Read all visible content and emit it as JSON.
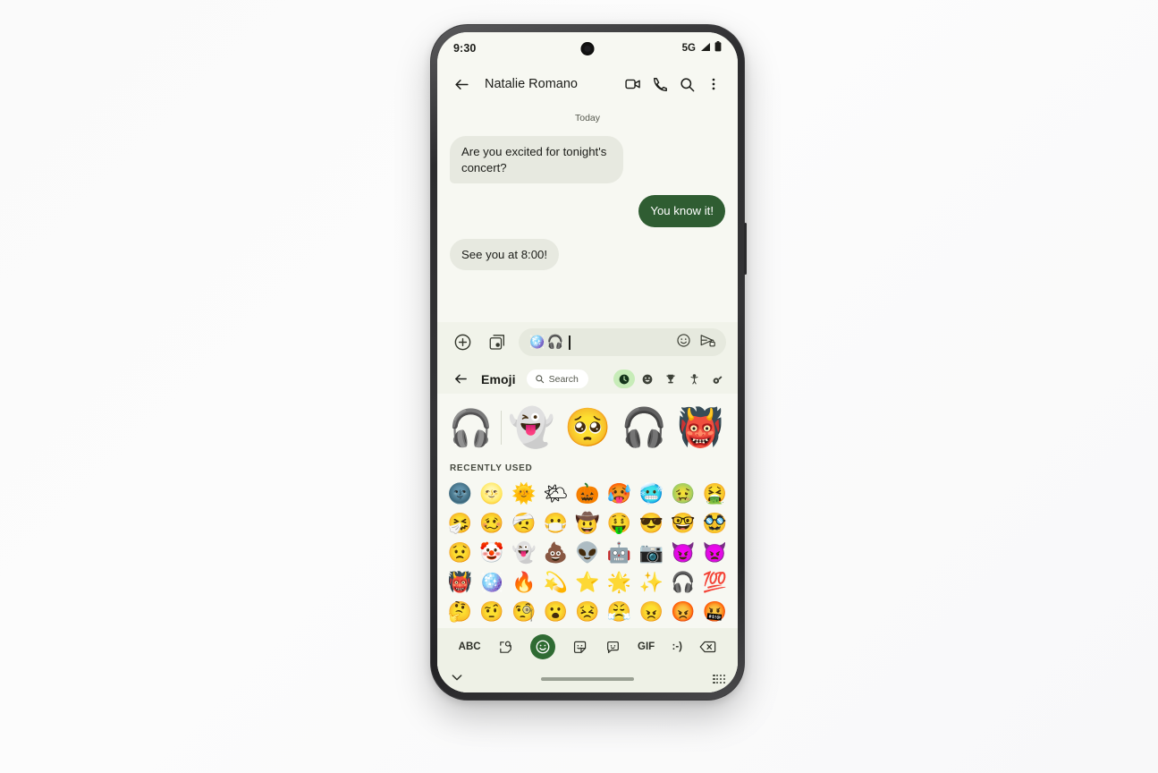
{
  "device": {
    "frame_color": "#3c3c3e",
    "screen_bg": "#f7f8f2"
  },
  "status_bar": {
    "time": "9:30",
    "network": "5G",
    "signal_icon": "signal-bars-icon",
    "battery_icon": "battery-icon"
  },
  "app_bar": {
    "back_icon": "back-arrow-icon",
    "contact_name": "Natalie Romano",
    "video_call_icon": "video-call-icon",
    "voice_call_icon": "phone-icon",
    "search_icon": "search-icon",
    "more_icon": "more-vert-icon"
  },
  "conversation": {
    "day_label": "Today",
    "messages": [
      {
        "text": "Are you excited for tonight's concert?",
        "side": "in"
      },
      {
        "text": "You know it!",
        "side": "out"
      },
      {
        "text": "See you at 8:00!",
        "side": "in"
      }
    ],
    "incoming_bubble_color": "#e7e9e0",
    "outgoing_bubble_color": "#2f5d32"
  },
  "compose_bar": {
    "add_icon": "plus-circle-icon",
    "gallery_icon": "gallery-icon",
    "input_value": "🪩🎧",
    "input_emoji": [
      "🪩",
      "🎧"
    ],
    "emoji_icon": "emoji-face-icon",
    "send_icon": "send-encrypted-icon"
  },
  "emoji_panel": {
    "back_icon": "back-arrow-icon",
    "title": "Emoji",
    "search": {
      "placeholder": "Search",
      "icon": "search-icon"
    },
    "categories": [
      {
        "name": "recent",
        "glyph": "🕐",
        "icon": "clock-icon",
        "selected": true
      },
      {
        "name": "smileys",
        "glyph": "😀",
        "icon": "smiley-icon",
        "selected": false
      },
      {
        "name": "activities",
        "glyph": "🏆",
        "icon": "trophy-icon",
        "selected": false
      },
      {
        "name": "people",
        "glyph": "🙋",
        "icon": "person-icon",
        "selected": false
      },
      {
        "name": "objects",
        "glyph": "🎸",
        "icon": "guitar-icon",
        "selected": false
      }
    ],
    "sticker_suggestions": [
      {
        "name": "blue-headphones-sticker",
        "glyph": "🎧"
      },
      {
        "name": "ghost-headphones-sticker",
        "glyph": "👻"
      },
      {
        "name": "pleading-headphones-sticker",
        "glyph": "🥺"
      },
      {
        "name": "sparkle-headphones-sticker",
        "glyph": "🎧"
      },
      {
        "name": "ogre-headphones-sticker",
        "glyph": "👹"
      }
    ],
    "section_label": "RECENTLY USED",
    "grid_rows": [
      [
        "🌚",
        "🌝",
        "🌞",
        "🌤",
        "🎃",
        "🥵",
        "🥶",
        "🤢",
        "🤮"
      ],
      [
        "🤧",
        "🥴",
        "🤕",
        "😷",
        "🤠",
        "🤑",
        "😎",
        "🤓",
        "🥸"
      ],
      [
        "😟",
        "🤡",
        "👻",
        "💩",
        "👽",
        "🤖",
        "📷",
        "😈",
        "👿"
      ],
      [
        "👹",
        "🪩",
        "🔥",
        "💫",
        "⭐",
        "🌟",
        "✨",
        "🎧",
        "💯"
      ],
      [
        "🤔",
        "🤨",
        "🧐",
        "😮",
        "😣",
        "😤",
        "😠",
        "😡",
        "🤬"
      ]
    ]
  },
  "keyboard_toolbar": {
    "items": [
      {
        "name": "abc-key",
        "label": "ABC",
        "type": "text",
        "selected": false
      },
      {
        "name": "sticker-search-icon",
        "label": "",
        "type": "icon-sticker-search",
        "selected": false
      },
      {
        "name": "emoji-tab",
        "label": "",
        "type": "icon-emoji",
        "selected": true
      },
      {
        "name": "sticker-tab",
        "label": "",
        "type": "icon-sticker",
        "selected": false
      },
      {
        "name": "avatar-sticker-tab",
        "label": "",
        "type": "icon-avatar",
        "selected": false
      },
      {
        "name": "gif-tab",
        "label": "GIF",
        "type": "text",
        "selected": false
      },
      {
        "name": "emoticon-tab",
        "label": ":-)",
        "type": "text",
        "selected": false
      },
      {
        "name": "backspace-key",
        "label": "",
        "type": "icon-backspace",
        "selected": false
      }
    ]
  },
  "nav_bar": {
    "collapse_icon": "chevron-down-icon",
    "home_indicator": "home-indicator",
    "keyboard_switch_icon": "keyboard-dots-icon"
  }
}
